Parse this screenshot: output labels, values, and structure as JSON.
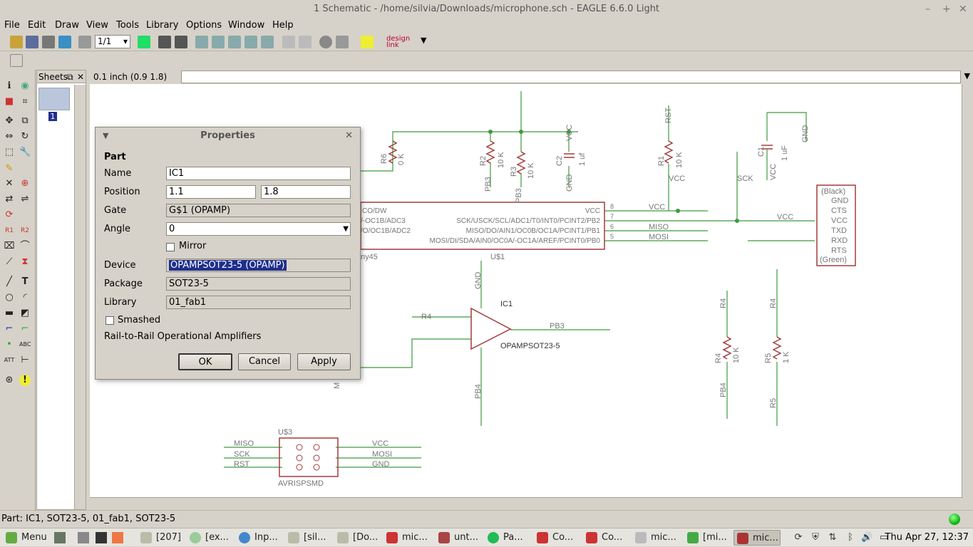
{
  "window": {
    "title": "1 Schematic - /home/silvia/Downloads/microphone.sch - EAGLE 6.6.0 Light"
  },
  "menu": [
    "File",
    "Edit",
    "Draw",
    "View",
    "Tools",
    "Library",
    "Options",
    "Window",
    "Help"
  ],
  "toolbar": {
    "zoom_select": "1/1",
    "design_link": "design link"
  },
  "sheets": {
    "label": "Sheets",
    "current": "1"
  },
  "coord": {
    "readout": "0.1 inch (0.9 1.8)"
  },
  "status": {
    "text": "Part: IC1, SOT23-5, 01_fab1, SOT23-5"
  },
  "dialog": {
    "title": "Properties",
    "section": "Part",
    "labels": {
      "name": "Name",
      "position": "Position",
      "gate": "Gate",
      "angle": "Angle",
      "mirror": "Mirror",
      "device": "Device",
      "package": "Package",
      "library": "Library",
      "smashed": "Smashed"
    },
    "values": {
      "name": "IC1",
      "pos_x": "1.1",
      "pos_y": "1.8",
      "gate": "G$1 (OPAMP)",
      "angle": "0",
      "device": "OPAMPSOT23-5 (OPAMP)",
      "package": "SOT23-5",
      "library": "01_fab1"
    },
    "mirror_checked": false,
    "smashed_checked": false,
    "description": "Rail-to-Rail Operational Amplifiers",
    "buttons": {
      "ok": "OK",
      "cancel": "Cancel",
      "apply": "Apply"
    }
  },
  "schematic": {
    "colors": {
      "wire": "#3d9a3d",
      "part": "#a33c3c",
      "text": "#777777"
    },
    "labels": {
      "r6": "R6",
      "r6v": "0 K",
      "r2": "R2",
      "r2v": "10 K",
      "r3": "R3",
      "r3v": "10 K",
      "c2": "C2",
      "c2v": "1 uf",
      "vcc": "VCC",
      "gnd": "GND",
      "rst": "RST",
      "r1": "R1",
      "r1v": "10 K",
      "c1": "C1",
      "c1v": "1 uF",
      "pb3": "PB3",
      "sck": "SCK",
      "miso": "MISO",
      "mosi": "MOSI",
      "black": "(Black)",
      "green": "(Green)",
      "cts": "CTS",
      "txd": "TXD",
      "rxd": "RXD",
      "rts": "RTS",
      "u1pins": [
        "CO/DW",
        "/-OC1B/ADC3",
        "/O/OC1B/ADC2",
        "ny45"
      ],
      "u1right": [
        "VCC",
        "SCK/USCK/SCL/ADC1/T0/INT0/PCINT2/PB2",
        "MISO/DO/AIN1/OC0B/OC1A/PCINT1/PB1",
        "MOSI/DI/SDA/AIN0/OC0A/-OC1A/AREF/PCINT0/PB0"
      ],
      "u1": "U$1",
      "ic1": "IC1",
      "opamp": "OPAMPSOT23-5",
      "r4": "R4",
      "r4v": "10 K",
      "r5": "R5",
      "r5v": "1 K",
      "pb4": "PB4",
      "m": "M",
      "u3": "U$3",
      "avr": "AVRISPSMD",
      "pins8": "8",
      "pins7": "7",
      "pins6": "6",
      "pins5": "5"
    }
  },
  "taskbar": {
    "menu": "Menu",
    "tasks": [
      "[207]",
      "[ex...",
      "Inp...",
      "[sil...",
      "[Do...",
      "mic...",
      "unt...",
      "Pa...",
      "Co...",
      "Co...",
      "mic...",
      "[mi...",
      "mic..."
    ],
    "clock": "Thu Apr 27, 12:37"
  }
}
